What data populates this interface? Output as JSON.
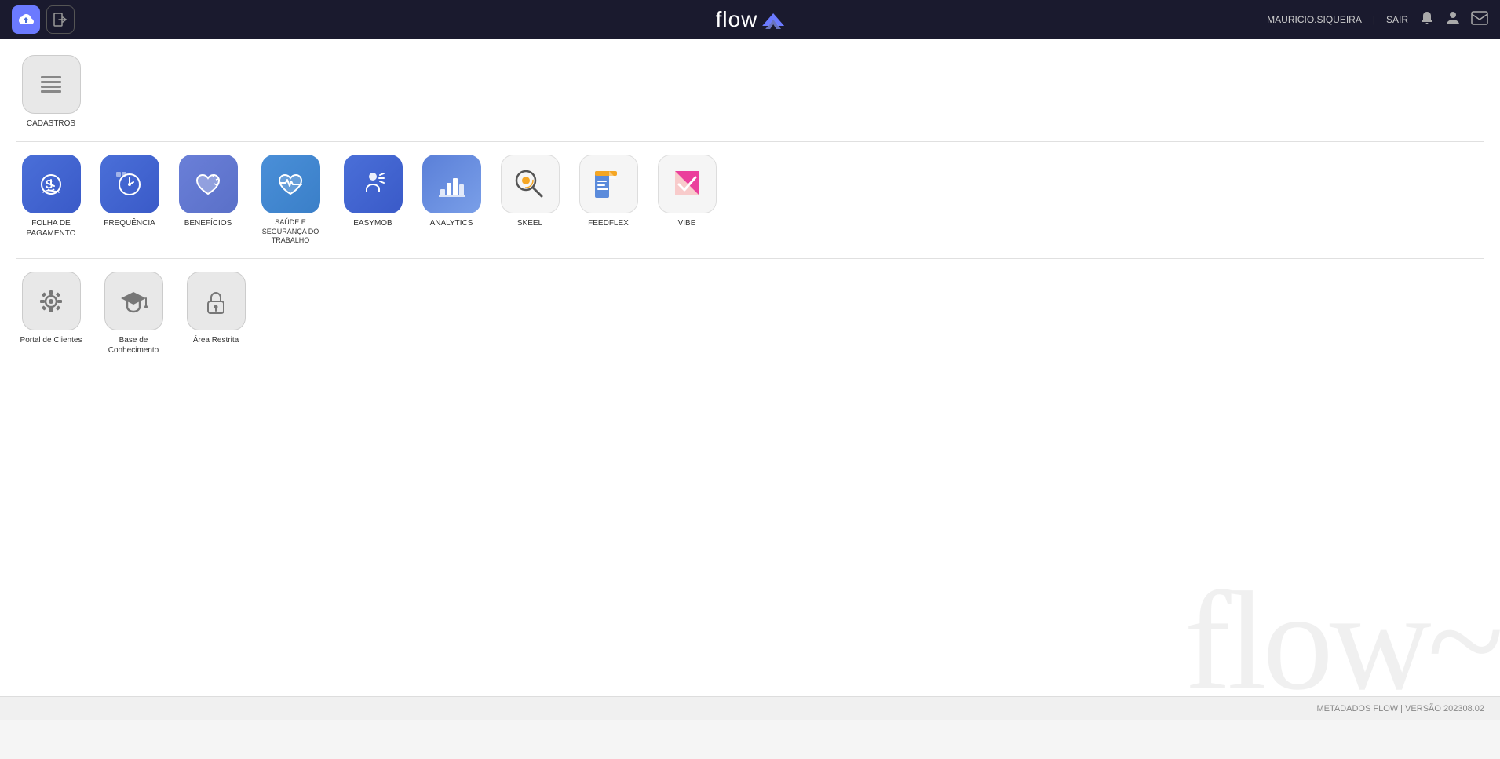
{
  "navbar": {
    "title": "flow",
    "user": "MAURICIO.SIQUEIRA",
    "separator": "|",
    "sair": "SAIR"
  },
  "footer": {
    "text": "METADADOS FLOW | VERSÃO 202308.02"
  },
  "sections": {
    "cadastros": {
      "label": "CADASTROS",
      "items": []
    },
    "apps": {
      "items": [
        {
          "id": "folha",
          "label": "FOLHA DE\nPAGAMENTO",
          "color": "blue"
        },
        {
          "id": "frequencia",
          "label": "FREQUÊNCIA",
          "color": "blue"
        },
        {
          "id": "beneficios",
          "label": "BENEFÍCIOS",
          "color": "blue-purple"
        },
        {
          "id": "saude",
          "label": "SAÚDE E\nSEGURANÇA DO\nTRABALHO",
          "color": "blue"
        },
        {
          "id": "easymob",
          "label": "EASYMOB",
          "color": "blue"
        },
        {
          "id": "analytics",
          "label": "ANALYTICS",
          "color": "blue"
        },
        {
          "id": "skeel",
          "label": "SKEEL",
          "color": "white"
        },
        {
          "id": "feedflex",
          "label": "FEEDFLEX",
          "color": "white"
        },
        {
          "id": "vibe",
          "label": "VIBE",
          "color": "white"
        }
      ]
    },
    "portal": {
      "items": [
        {
          "id": "portal-clientes",
          "label": "Portal de Clientes"
        },
        {
          "id": "base-conhecimento",
          "label": "Base de\nConhecimento"
        },
        {
          "id": "area-restrita",
          "label": "Área Restrita"
        }
      ]
    }
  }
}
